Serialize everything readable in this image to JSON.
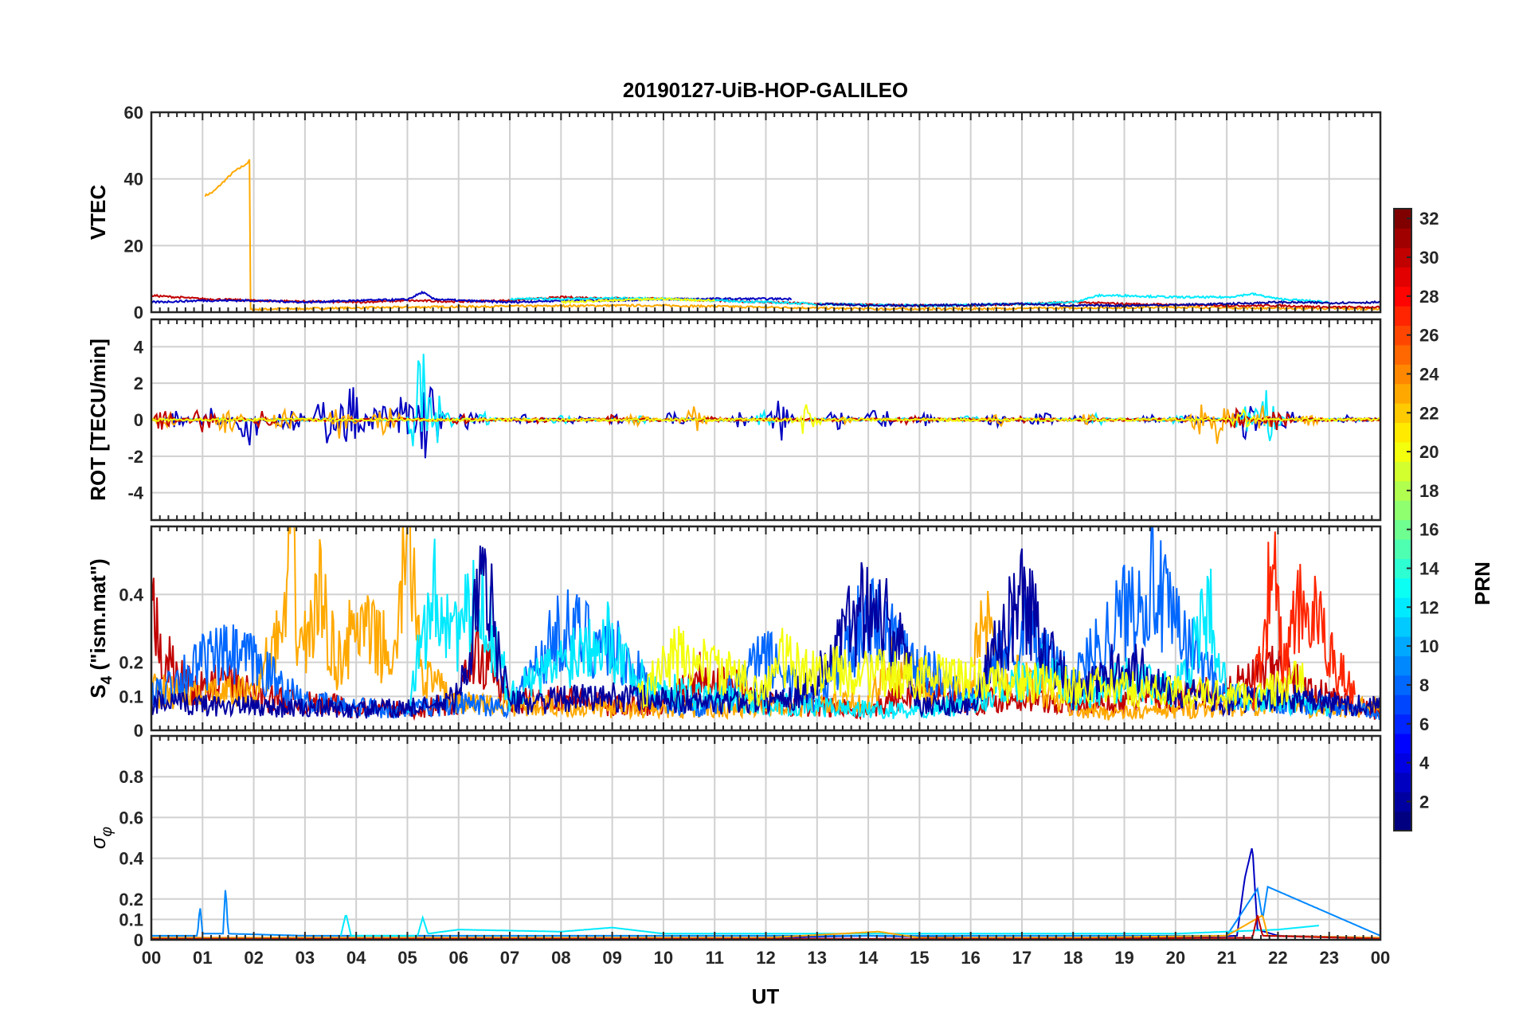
{
  "chart_data": {
    "type": "line",
    "title": "20190127-UiB-HOP-GALILEO",
    "xlabel": "UT",
    "x_ticks": [
      "00",
      "01",
      "02",
      "03",
      "04",
      "05",
      "06",
      "07",
      "08",
      "09",
      "10",
      "11",
      "12",
      "13",
      "14",
      "15",
      "16",
      "17",
      "18",
      "19",
      "20",
      "21",
      "22",
      "23",
      "00"
    ],
    "x_range_hours": [
      0,
      24
    ],
    "grid": true,
    "colorbar": {
      "label": "PRN",
      "range": [
        1,
        32
      ],
      "ticks": [
        "2",
        "4",
        "6",
        "8",
        "10",
        "12",
        "14",
        "16",
        "18",
        "20",
        "22",
        "24",
        "26",
        "28",
        "30",
        "32"
      ],
      "colormap": "jet",
      "placement": "right"
    },
    "panels": [
      {
        "id": "vtec",
        "ylabel": "VTEC",
        "ylim": [
          0,
          60
        ],
        "yticks": [
          0,
          20,
          40,
          60
        ],
        "ytick_labels": [
          "0",
          "20",
          "40",
          "60"
        ],
        "series": [
          {
            "prn": 23,
            "x": [
              1.05,
              1.2,
              1.4,
              1.6,
              1.9,
              1.92,
              1.93,
              2.5,
              3.5,
              5,
              7,
              9,
              10,
              12,
              14,
              16,
              18,
              20,
              22,
              24
            ],
            "y": [
              35,
              36,
              39,
              42,
              45,
              46,
              0.8,
              1,
              1.2,
              1.5,
              1.8,
              2,
              2,
              1.5,
              1,
              1,
              1.3,
              1.5,
              1.2,
              1
            ]
          },
          {
            "prn": 30,
            "x": [
              0,
              0.5,
              1,
              2,
              3,
              4,
              5,
              6,
              7,
              8,
              9,
              10,
              11,
              12,
              13,
              14,
              15,
              16,
              17,
              18,
              19,
              20,
              21,
              22,
              23,
              24
            ],
            "y": [
              5,
              4.5,
              4,
              3.5,
              3.2,
              3,
              3.5,
              3.2,
              3.5,
              4.5,
              4.2,
              4,
              3.5,
              3,
              2.5,
              2.2,
              2,
              2,
              2.5,
              3,
              2.5,
              2.2,
              2,
              2,
              1.5,
              1.5
            ]
          },
          {
            "prn": 3,
            "x": [
              0,
              1,
              2,
              3,
              4,
              5,
              5.3,
              5.5,
              6,
              7,
              8,
              9,
              10,
              11,
              12,
              12.5
            ],
            "y": [
              3,
              3.5,
              3.5,
              3,
              3.5,
              3.8,
              6,
              4,
              3.5,
              3,
              3.5,
              3.5,
              4,
              4,
              4,
              4
            ]
          },
          {
            "prn": 12,
            "x": [
              7,
              8,
              9,
              10,
              11,
              12,
              13,
              14,
              15,
              16,
              17,
              18,
              18.5,
              19,
              20,
              21,
              21.5,
              22,
              23
            ],
            "y": [
              4,
              4,
              4.2,
              4,
              3.5,
              3,
              2.5,
              2.2,
              2,
              2.2,
              2.5,
              3,
              5,
              5,
              4.5,
              4.5,
              5.5,
              4,
              3
            ]
          },
          {
            "prn": 2,
            "x": [
              13,
              14,
              15,
              16,
              17,
              18,
              19,
              20,
              21,
              22,
              23,
              24
            ],
            "y": [
              2.5,
              2,
              2,
              2.2,
              2.5,
              2,
              2,
              2.2,
              2.5,
              3,
              2.8,
              3
            ]
          },
          {
            "prn": 20,
            "x": [
              8,
              9,
              10,
              11
            ],
            "y": [
              3,
              3.5,
              4,
              3.5
            ]
          }
        ]
      },
      {
        "id": "rot",
        "ylabel": "ROT [TECU/min]",
        "ylim": [
          -5.5,
          5.5
        ],
        "yticks": [
          -4,
          -2,
          0,
          2,
          4
        ],
        "ytick_labels": [
          "-4",
          "-2",
          "0",
          "2",
          "4"
        ],
        "series": [
          {
            "prn": 3,
            "x": [
              0.5,
              1.2,
              1.9,
              2.7,
              3.4,
              3.9,
              4.5,
              5.0,
              5.4,
              6.2,
              7.3,
              8.3,
              9.1,
              10.2,
              11.5,
              12.3,
              13.4,
              14.2,
              15.1,
              16.5,
              17.4,
              18.2,
              19.5,
              20.3,
              21.4,
              22.2,
              23.4
            ],
            "amp": [
              0.5,
              0.8,
              1.6,
              1.0,
              1.5,
              2.2,
              1.2,
              2.5,
              2.8,
              0.6,
              0.3,
              0.3,
              0.3,
              0.5,
              0.5,
              1.3,
              0.6,
              0.9,
              0.5,
              0.4,
              0.5,
              0.4,
              0.3,
              0.3,
              1.2,
              0.6,
              0.3
            ]
          },
          {
            "prn": 12,
            "x": [
              5.3,
              5.6,
              6.5,
              8.0,
              9.5,
              12.0,
              16.0,
              18.5,
              20.0,
              21.4,
              21.8
            ],
            "amp": [
              4.5,
              1.6,
              0.4,
              0.3,
              0.3,
              0.5,
              0.3,
              0.4,
              0.3,
              1.2,
              1.8
            ]
          },
          {
            "prn": 23,
            "x": [
              0.3,
              1.5,
              2.6,
              3.7,
              4.6,
              9.5,
              10.6,
              13.5,
              16.6,
              18.3,
              20.5,
              20.9,
              21.7,
              22.6
            ],
            "amp": [
              0.5,
              1.0,
              0.8,
              1.2,
              1.0,
              0.4,
              0.8,
              0.3,
              0.4,
              0.4,
              0.9,
              1.8,
              0.9,
              0.4
            ]
          },
          {
            "prn": 30,
            "x": [
              0.2,
              1.0,
              2.2,
              6.0,
              7.5,
              9.0,
              11.0,
              14.8,
              17.0,
              21.2,
              22.0
            ],
            "amp": [
              0.6,
              0.8,
              0.6,
              0.4,
              0.3,
              0.3,
              0.2,
              0.3,
              0.2,
              0.6,
              0.7
            ]
          },
          {
            "prn": 20,
            "x": [
              12.8,
              21.3
            ],
            "amp": [
              1.0,
              0.6
            ]
          }
        ]
      },
      {
        "id": "s4",
        "ylabel": "S4 (\"ism.mat\")",
        "ylabel_main": "S",
        "ylabel_sub": "4",
        "ylabel_rest": " (\"ism.mat\")",
        "ylim": [
          0,
          0.6
        ],
        "yticks": [
          0,
          0.1,
          0.2,
          0.4
        ],
        "ytick_labels": [
          "0",
          "0.1",
          "0.2",
          "0.4"
        ],
        "series": [
          {
            "prn": 30,
            "x": [
              0,
              0.2,
              0.5,
              1,
              1.5,
              2,
              3,
              4,
              5,
              6,
              6.3,
              7,
              8,
              9,
              10,
              10.8,
              12,
              13,
              14,
              15,
              16,
              17,
              18,
              19,
              20,
              21,
              22,
              22.5,
              23,
              24
            ],
            "y": [
              0.35,
              0.25,
              0.15,
              0.12,
              0.15,
              0.1,
              0.08,
              0.07,
              0.06,
              0.08,
              0.25,
              0.08,
              0.1,
              0.07,
              0.08,
              0.18,
              0.08,
              0.07,
              0.06,
              0.12,
              0.08,
              0.1,
              0.07,
              0.08,
              0.1,
              0.12,
              0.18,
              0.12,
              0.1,
              0.05
            ]
          },
          {
            "prn": 23,
            "x": [
              0,
              1,
              2,
              2.6,
              2.75,
              2.85,
              3.0,
              3.3,
              3.6,
              4.0,
              4.5,
              4.8,
              4.95,
              5.1,
              5.3,
              6,
              8,
              10,
              12,
              14,
              14.5,
              15,
              16,
              16.2,
              16.5,
              17,
              18,
              19,
              20,
              21,
              22,
              23,
              24
            ],
            "y": [
              0.12,
              0.1,
              0.12,
              0.3,
              0.6,
              0.3,
              0.25,
              0.4,
              0.2,
              0.3,
              0.25,
              0.2,
              0.6,
              0.5,
              0.16,
              0.08,
              0.07,
              0.06,
              0.07,
              0.08,
              0.2,
              0.15,
              0.1,
              0.38,
              0.2,
              0.15,
              0.06,
              0.05,
              0.06,
              0.07,
              0.08,
              0.06,
              0.07
            ]
          },
          {
            "prn": 8,
            "x": [
              0,
              1,
              1.5,
              2,
              3,
              4,
              5,
              6,
              7,
              8,
              9,
              10,
              11,
              12,
              13,
              14,
              15,
              16,
              17,
              17.5,
              18,
              19,
              19.5,
              20,
              21,
              22,
              23,
              24
            ],
            "y": [
              0.1,
              0.2,
              0.22,
              0.2,
              0.08,
              0.07,
              0.06,
              0.08,
              0.07,
              0.3,
              0.25,
              0.08,
              0.07,
              0.22,
              0.08,
              0.35,
              0.2,
              0.08,
              0.3,
              0.2,
              0.15,
              0.35,
              0.45,
              0.3,
              0.1,
              0.08,
              0.07,
              0.06
            ]
          },
          {
            "prn": 12,
            "x": [
              5,
              5.5,
              6,
              6.5,
              7,
              8,
              8.8,
              9.5,
              10,
              11,
              12,
              13,
              14,
              15,
              16,
              17,
              17.5,
              18,
              19,
              20,
              20.7,
              21,
              22,
              23
            ],
            "y": [
              0.06,
              0.4,
              0.3,
              0.38,
              0.1,
              0.2,
              0.3,
              0.15,
              0.12,
              0.1,
              0.08,
              0.07,
              0.06,
              0.06,
              0.08,
              0.15,
              0.2,
              0.1,
              0.15,
              0.12,
              0.35,
              0.1,
              0.08,
              0.07
            ]
          },
          {
            "prn": 2,
            "x": [
              0,
              2,
              4,
              5.5,
              6,
              6.5,
              7,
              9,
              11,
              12.5,
              13,
              14,
              14.5,
              15,
              16,
              17,
              18,
              19,
              20,
              21,
              22,
              23,
              24
            ],
            "y": [
              0.08,
              0.07,
              0.06,
              0.07,
              0.1,
              0.45,
              0.08,
              0.1,
              0.08,
              0.1,
              0.15,
              0.4,
              0.3,
              0.08,
              0.07,
              0.4,
              0.1,
              0.2,
              0.12,
              0.08,
              0.1,
              0.08,
              0.07
            ]
          },
          {
            "prn": 20,
            "x": [
              9.5,
              10,
              10.3,
              12,
              12.3,
              12.6,
              21.5,
              22.5
            ],
            "y": [
              0.1,
              0.18,
              0.22,
              0.12,
              0.22,
              0.18,
              0.1,
              0.15
            ]
          },
          {
            "prn": 27,
            "x": [
              21.5,
              21.9,
              22.1,
              22.5,
              23.5
            ],
            "y": [
              0.08,
              0.48,
              0.2,
              0.38,
              0.1
            ]
          }
        ]
      },
      {
        "id": "sigma",
        "ylabel": "σφ",
        "ylabel_main": "σ",
        "ylabel_sub": "φ",
        "ylim": [
          0,
          1
        ],
        "yticks": [
          0,
          0.1,
          0.2,
          0.4,
          0.6,
          0.8
        ],
        "ytick_labels": [
          "0",
          "0.1",
          "0.2",
          "0.4",
          "0.6",
          "0.8"
        ],
        "series": [
          {
            "prn": 3,
            "x": [
              0,
              2,
              4,
              6,
              8,
              10,
              12,
              14,
              16,
              18,
              20,
              21.2,
              21.35,
              21.5,
              21.6,
              22,
              24
            ],
            "y": [
              0.01,
              0.01,
              0.01,
              0.01,
              0.01,
              0.01,
              0.01,
              0.02,
              0.01,
              0.01,
              0.01,
              0.02,
              0.3,
              0.46,
              0.05,
              0.02,
              0.01
            ]
          },
          {
            "prn": 9,
            "x": [
              0,
              0.9,
              0.95,
              1.0,
              1.4,
              1.45,
              1.5,
              3,
              5,
              7,
              9,
              11,
              13,
              15,
              17,
              19,
              21,
              21.6,
              21.7,
              21.8,
              24
            ],
            "y": [
              0.02,
              0.02,
              0.17,
              0.03,
              0.03,
              0.27,
              0.03,
              0.02,
              0.02,
              0.02,
              0.02,
              0.02,
              0.02,
              0.02,
              0.02,
              0.02,
              0.02,
              0.25,
              0.1,
              0.26,
              0.02
            ]
          },
          {
            "prn": 12,
            "x": [
              3.7,
              3.8,
              3.9,
              5.2,
              5.3,
              5.4,
              6,
              8,
              9,
              10,
              18,
              20,
              21,
              22,
              22.8
            ],
            "y": [
              0.02,
              0.13,
              0.02,
              0.02,
              0.11,
              0.03,
              0.05,
              0.04,
              0.06,
              0.03,
              0.03,
              0.03,
              0.04,
              0.05,
              0.07
            ]
          },
          {
            "prn": 23,
            "x": [
              0,
              3,
              6,
              9,
              12,
              14.2,
              15,
              18,
              21,
              21.7,
              21.8,
              24
            ],
            "y": [
              0.01,
              0.01,
              0.01,
              0.01,
              0.01,
              0.04,
              0.01,
              0.01,
              0.02,
              0.12,
              0.02,
              0.01
            ]
          },
          {
            "prn": 30,
            "x": [
              0,
              6,
              12,
              18,
              21.5,
              21.6,
              21.7,
              24
            ],
            "y": [
              0.005,
              0.005,
              0.005,
              0.005,
              0.01,
              0.12,
              0.02,
              0.005
            ]
          }
        ]
      }
    ]
  }
}
